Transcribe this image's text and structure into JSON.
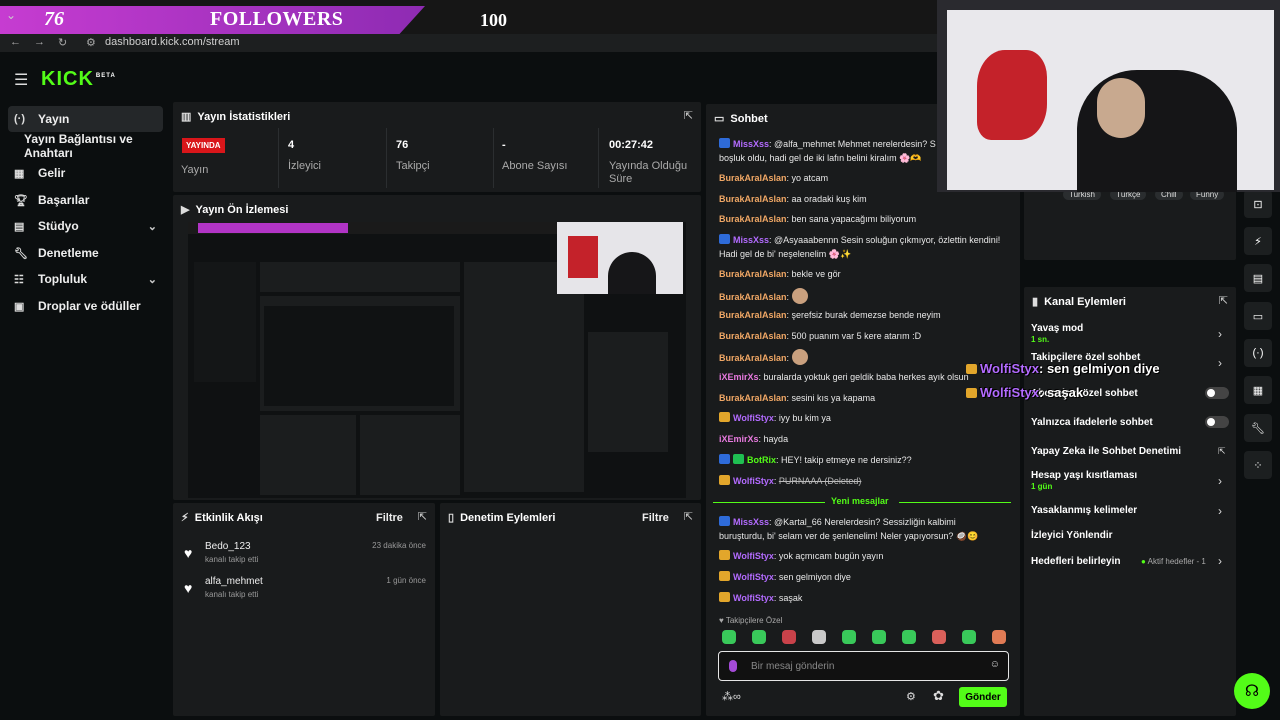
{
  "followers_bar": {
    "count_left": "76",
    "label": "FOLLOWERS",
    "goal": "100"
  },
  "browser": {
    "url": "dashboard.kick.com/stream"
  },
  "logo": {
    "text": "KICK",
    "sup": "BETA"
  },
  "sidebar": {
    "items": [
      {
        "label": "Yayın",
        "icon": "broadcast-icon"
      },
      {
        "label": "Yayın Bağlantısı ve Anahtarı"
      },
      {
        "label": "Gelir",
        "icon": "chart-icon"
      },
      {
        "label": "Başarılar",
        "icon": "trophy-icon"
      },
      {
        "label": "Stüdyo",
        "icon": "studio-icon"
      },
      {
        "label": "Denetleme",
        "icon": "wrench-icon"
      },
      {
        "label": "Topluluk",
        "icon": "community-icon"
      },
      {
        "label": "Droplar ve ödüller",
        "icon": "gift-icon"
      }
    ]
  },
  "stats": {
    "title": "Yayın İstatistikleri",
    "live_badge": "YAYINDA",
    "status_label": "Yayın",
    "viewers_value": "4",
    "viewers_label": "İzleyici",
    "followers_value": "76",
    "followers_label": "Takipçi",
    "subs_value": "-",
    "subs_label": "Abone Sayısı",
    "duration_value": "00:27:42",
    "duration_label": "Yayında Olduğu Süre"
  },
  "preview": {
    "title": "Yayın Ön İzlemesi"
  },
  "activity": {
    "title": "Etkinlik Akışı",
    "filter": "Filtre",
    "items": [
      {
        "name": "Bedo_123",
        "sub": "kanalı takip etti",
        "time": "23 dakika önce"
      },
      {
        "name": "alfa_mehmet",
        "sub": "kanalı takip etti",
        "time": "1 gün önce"
      }
    ]
  },
  "moderation": {
    "title": "Denetim Eylemleri",
    "filter": "Filtre"
  },
  "chat": {
    "title": "Sohbet",
    "messages": [
      {
        "user": "MissXss",
        "text": "@alfa_mehmet Mehmet nerelerdesin? S",
        "text2": "boşluk oldu, hadi gel de iki lafın belini kiralım 🌸🫶",
        "color": "pu",
        "badge": "b-blue"
      },
      {
        "user": "BurakAralAslan",
        "text": "yo atcam",
        "color": "or"
      },
      {
        "user": "BurakAralAslan",
        "text": "aa oradaki kuş kim",
        "color": "or"
      },
      {
        "user": "BurakAralAslan",
        "text": "ben sana yapacağımı biliyorum",
        "color": "or"
      },
      {
        "user": "MissXss",
        "text": "@Asyaaabennn Sesin soluğun çıkmıyor, özlettin kendini!",
        "text2": "Hadi gel de bi' neşelenelim 🌸✨",
        "color": "pu",
        "badge": "b-blue"
      },
      {
        "user": "BurakAralAslan",
        "text": "bekle ve gör",
        "color": "or"
      },
      {
        "user": "BurakAralAslan",
        "text": "",
        "color": "or",
        "emote": true
      },
      {
        "user": "BurakAralAslan",
        "text": "şerefsiz burak demezse bende neyim",
        "color": "or"
      },
      {
        "user": "BurakAralAslan",
        "text": "500 puanım var 5 kere atarım :D",
        "color": "or"
      },
      {
        "user": "BurakAralAslan",
        "text": "",
        "color": "or",
        "emote": true
      },
      {
        "user": "iXEmirXs",
        "text": "buralarda yoktuk geri geldik baba herkes ayık olsun",
        "color": "pk"
      },
      {
        "user": "BurakAralAslan",
        "text": "sesini kıs ya kapama",
        "color": "or"
      },
      {
        "user": "WolfiStyx",
        "text": "iyy bu kim ya",
        "color": "pu",
        "badge": "b-gold"
      },
      {
        "user": "iXEmirXs",
        "text": "hayda",
        "color": "pk"
      },
      {
        "user": "BotRix",
        "text": "HEY! takip etmeye ne dersiniz??",
        "color": "gr",
        "badge": "b-blue",
        "badge2": "b-green"
      },
      {
        "user": "WolfiStyx",
        "text": "PURNAAA (Deleted)",
        "color": "pu",
        "badge": "b-gold",
        "deleted": true
      }
    ],
    "new_label": "Yeni mesajlar",
    "new_messages": [
      {
        "user": "MissXss",
        "text": "@Kartal_66 Nerelerdesin? Sessizliğin kalbimi",
        "text2": "buruşturdu, bi' selam ver de şenlenelim! Neler yapıyorsun? 🥥😊",
        "color": "pu",
        "badge": "b-blue"
      },
      {
        "user": "WolfiStyx",
        "text": "yok açmıcam bugün yayın",
        "color": "pu",
        "badge": "b-gold"
      },
      {
        "user": "WolfiStyx",
        "text": "sen gelmiyon diye",
        "color": "pu",
        "badge": "b-gold"
      },
      {
        "user": "WolfiStyx",
        "text": "saşak",
        "color": "pu",
        "badge": "b-gold"
      }
    ],
    "followers_only": "Takipçilere Özel",
    "placeholder": "Bir mesaj gönderin",
    "send": "Gönder"
  },
  "tags": [
    "Turkish",
    "Türkçe",
    "Chill",
    "Funny"
  ],
  "channel_actions": {
    "title": "Kanal Eylemleri",
    "items": [
      {
        "label": "Yavaş mod",
        "sub": "1 sn.",
        "control": "arrow"
      },
      {
        "label": "Takipçilere özel sohbet",
        "control": "arrow"
      },
      {
        "label": "Abonelere özel sohbet",
        "control": "toggle"
      },
      {
        "label": "Yalnızca ifadelerle sohbet",
        "control": "toggle"
      },
      {
        "label": "Yapay Zeka ile Sohbet Denetimi",
        "control": "popout"
      },
      {
        "label": "Hesap yaşı kısıtlaması",
        "sub": "1 gün",
        "control": "arrow"
      },
      {
        "label": "Yasaklanmış kelimeler",
        "control": "arrow"
      },
      {
        "label": "İzleyici Yönlendir",
        "control": "none"
      },
      {
        "label": "Hedefleri belirleyin",
        "note": "Aktif hedefler - 1",
        "control": "arrow"
      }
    ]
  },
  "overlay_alerts": [
    {
      "user": "WolfiStyx",
      "text": ": sen gelmiyon diye"
    },
    {
      "user": "WolfiStyx",
      "text": ": saşak"
    }
  ],
  "colors": {
    "accent": "#53fc18",
    "live": "#d9161a",
    "panel": "#191b1c"
  }
}
